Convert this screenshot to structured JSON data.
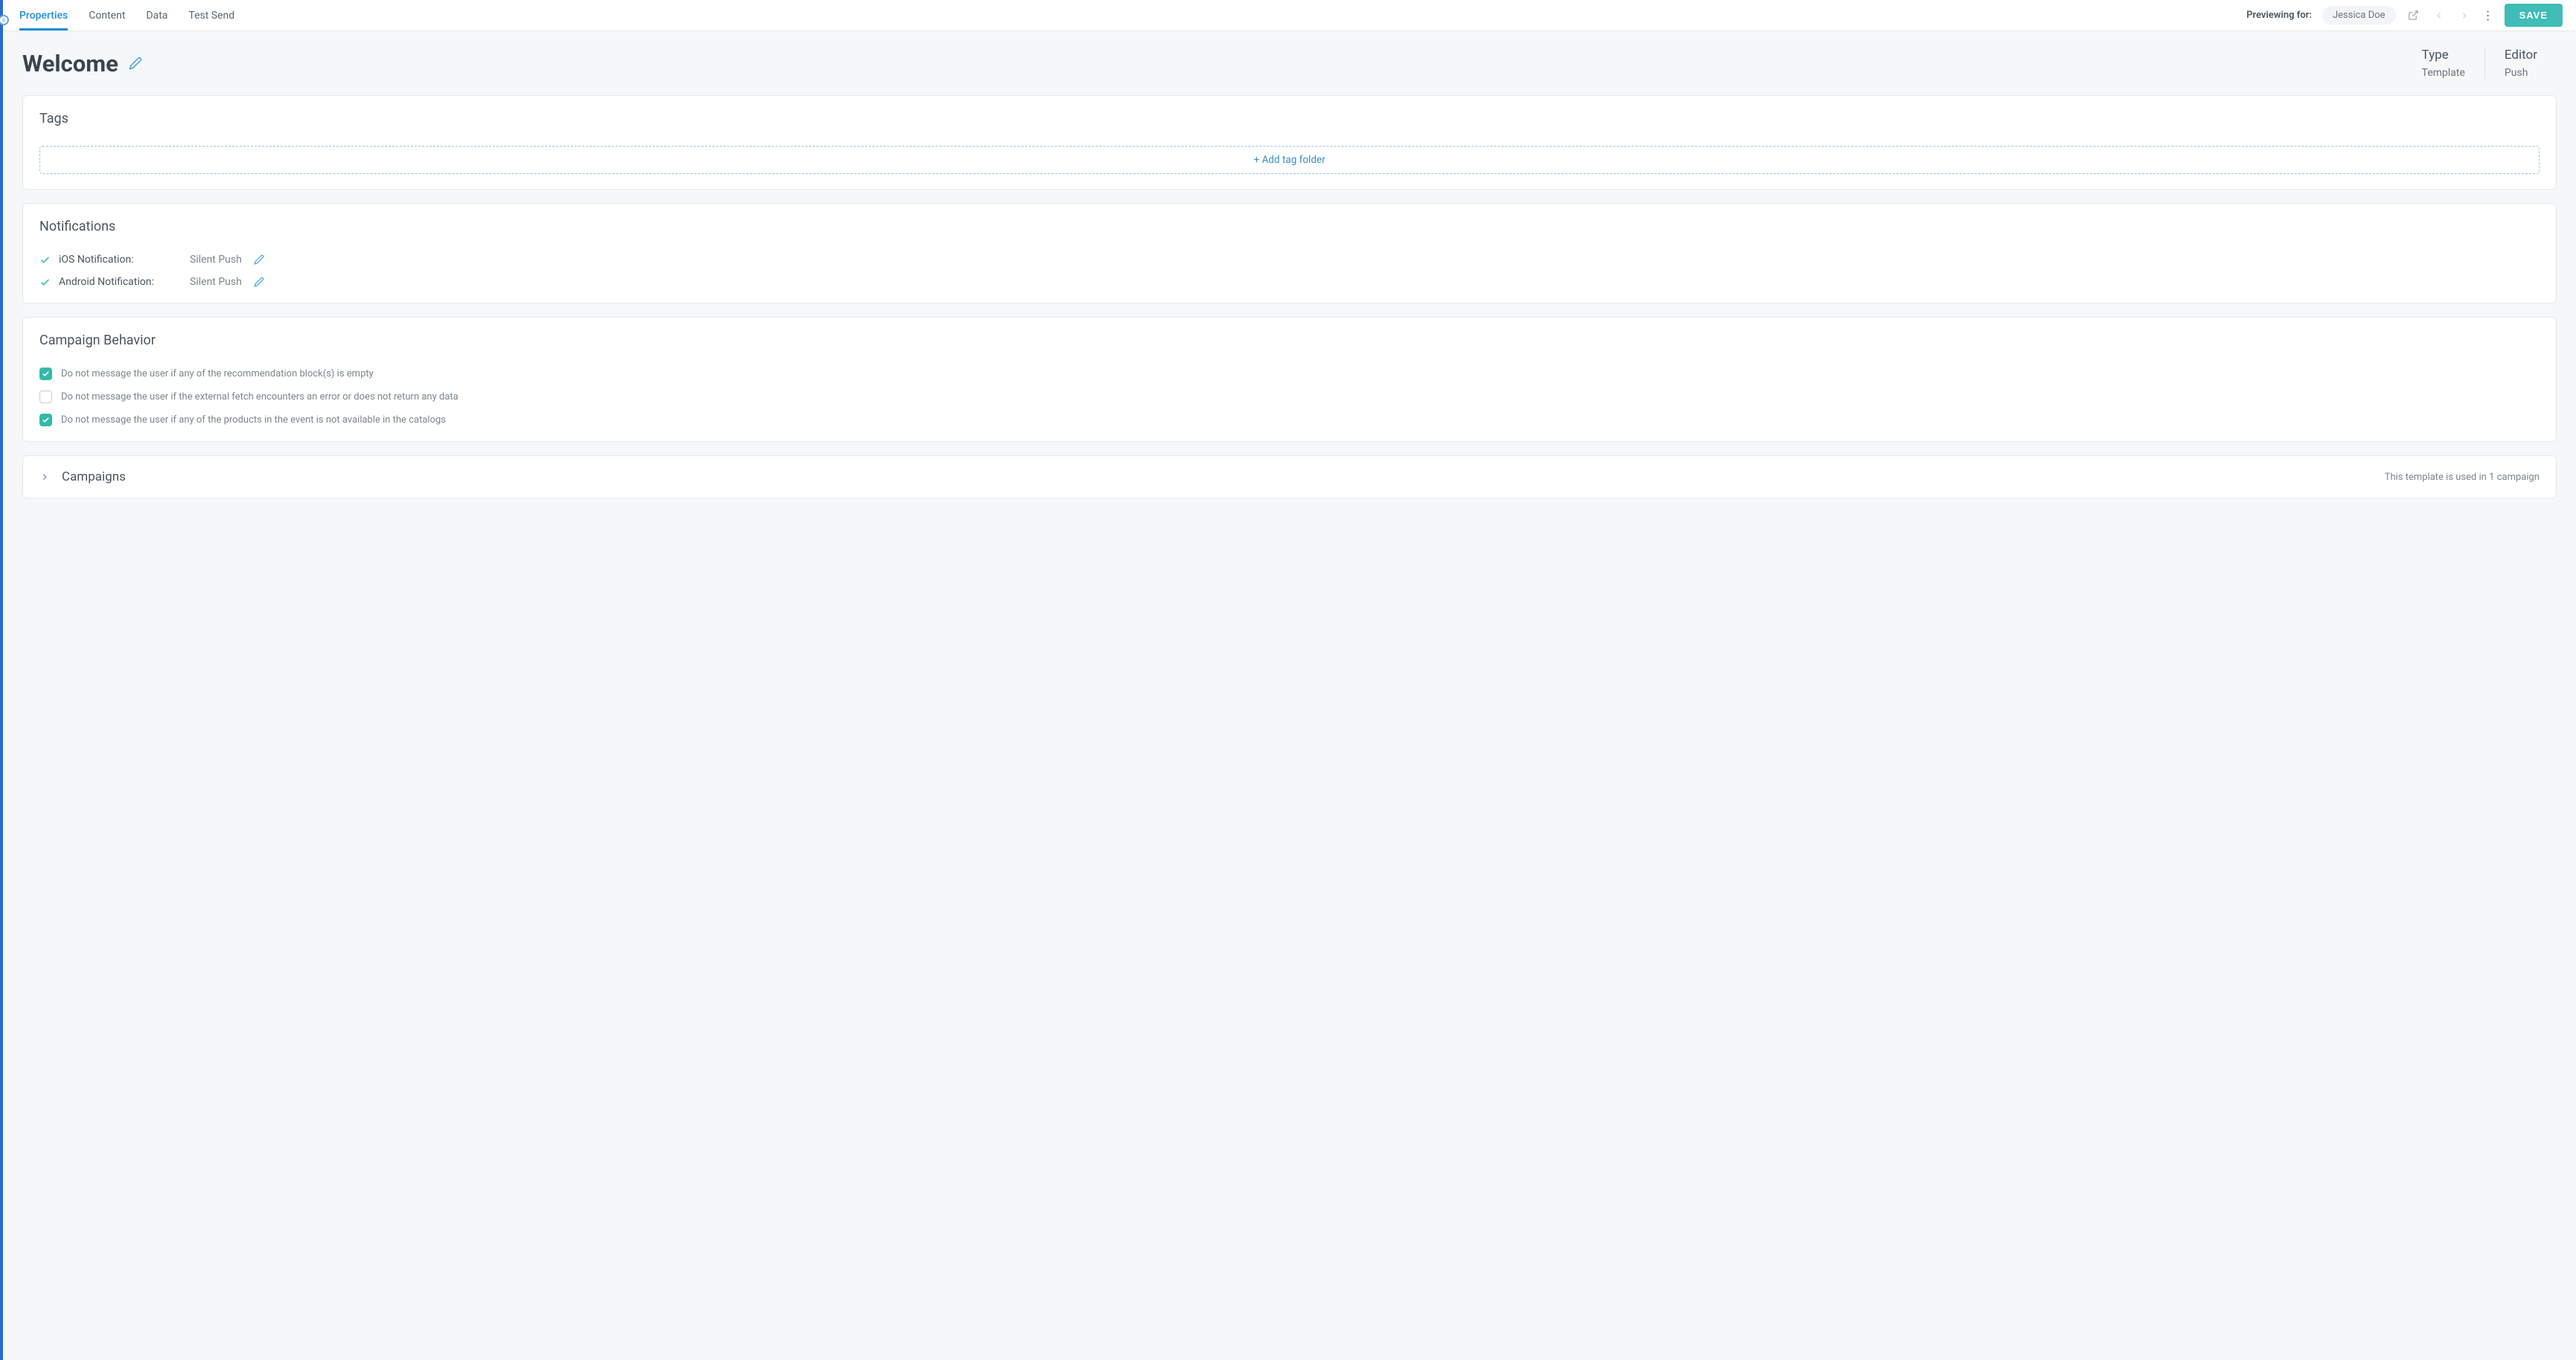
{
  "tabs": {
    "properties": "Properties",
    "content": "Content",
    "data": "Data",
    "test_send": "Test Send"
  },
  "topbar": {
    "preview_label": "Previewing for:",
    "preview_user": "Jessica Doe",
    "save_label": "SAVE"
  },
  "header": {
    "title": "Welcome",
    "type_label": "Type",
    "type_value": "Template",
    "editor_label": "Editor",
    "editor_value": "Push"
  },
  "tags_card": {
    "title": "Tags",
    "add_label": "+ Add tag folder"
  },
  "notifications_card": {
    "title": "Notifications",
    "ios_label": "iOS Notification:",
    "ios_value": "Silent Push",
    "android_label": "Android Notification:",
    "android_value": "Silent Push"
  },
  "behavior_card": {
    "title": "Campaign Behavior",
    "opt1": "Do not message the user if any of the recommendation block(s) is empty",
    "opt2": "Do not message the user if the external fetch encounters an error or does not return any data",
    "opt3": "Do not message the user if any of the products in the event is not available in the catalogs"
  },
  "campaigns_card": {
    "title": "Campaigns",
    "status": "This template is used in 1 campaign"
  }
}
